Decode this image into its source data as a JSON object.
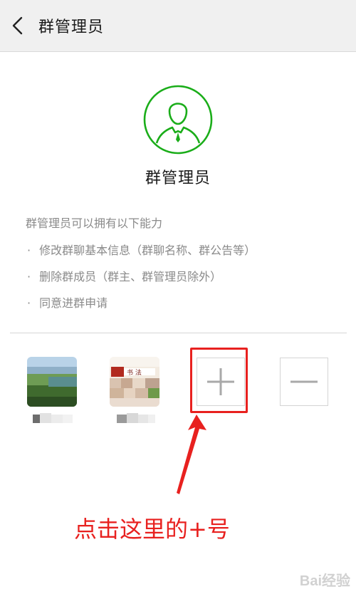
{
  "header": {
    "title": "群管理员"
  },
  "role": {
    "name": "群管理员",
    "accent_color": "#1aad19"
  },
  "abilities": {
    "intro": "群管理员可以拥有以下能力",
    "items": [
      "修改群聊基本信息（群聊名称、群公告等）",
      "删除群成员（群主、群管理员除外）",
      "同意进群申请"
    ]
  },
  "members": [
    {
      "avatar_desc": "landscape-photo-avatar"
    },
    {
      "avatar_desc": "calligraphy-avatar"
    }
  ],
  "actions": {
    "add_symbol": "+",
    "remove_symbol": "−"
  },
  "annotation": {
    "text": "点击这里的+号",
    "color": "#e8211f"
  },
  "watermark": {
    "text": "Bai经验"
  }
}
